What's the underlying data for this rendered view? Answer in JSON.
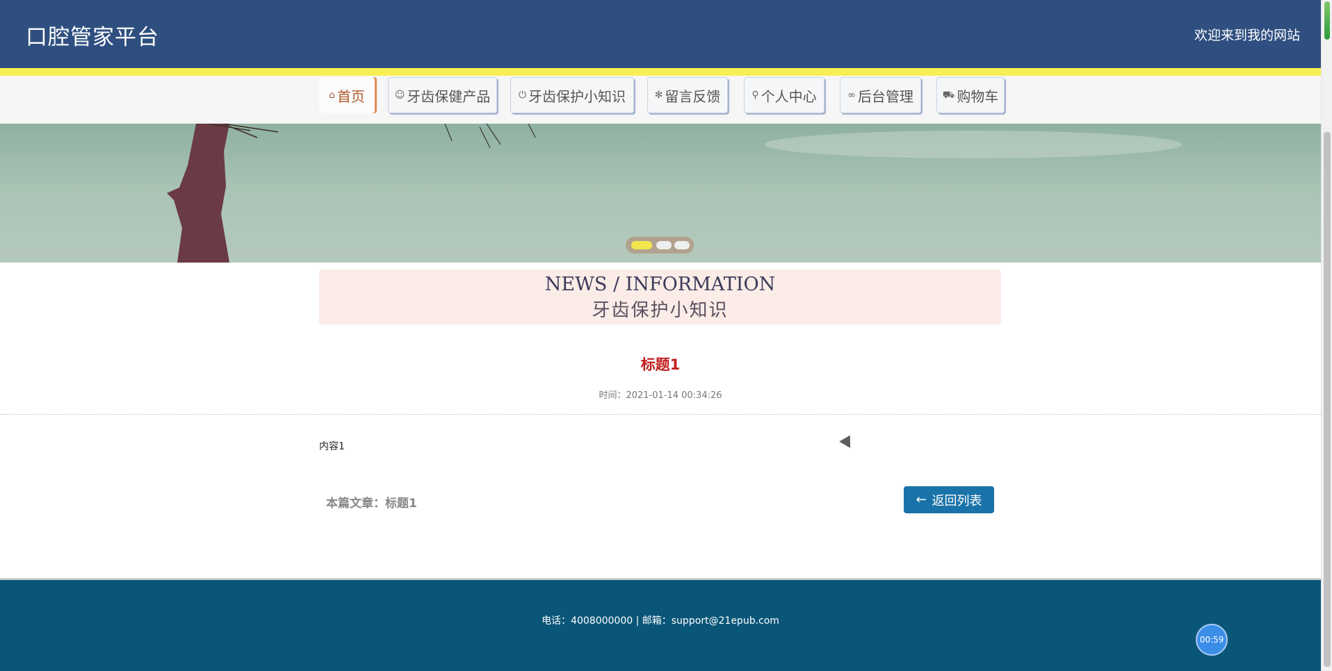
{
  "header": {
    "site_title": "口腔管家平台",
    "welcome_text": "欢迎来到我的网站"
  },
  "nav": {
    "items": [
      {
        "label": "首页",
        "icon": "⌂",
        "icon_name": "home-icon",
        "active": true
      },
      {
        "label": "牙齿保健产品",
        "icon": "☺",
        "icon_name": "smile-icon"
      },
      {
        "label": "牙齿保护小知识",
        "icon": "⏻",
        "icon_name": "power-icon"
      },
      {
        "label": "留言反馈",
        "icon": "✻",
        "icon_name": "snowflake-icon"
      },
      {
        "label": "个人中心",
        "icon": "⚲",
        "icon_name": "user-icon"
      },
      {
        "label": "后台管理",
        "icon": "∞",
        "icon_name": "link-icon"
      },
      {
        "label": "购物车",
        "icon": "⛟",
        "icon_name": "cart-icon"
      }
    ]
  },
  "carousel": {
    "slides": 3,
    "active_index": 0
  },
  "section": {
    "title_en": "NEWS / INFORMATION",
    "title_cn": "牙齿保护小知识"
  },
  "article": {
    "title": "标题1",
    "time": "时间：2021-01-14 00:34:26",
    "content": "内容1",
    "current_label": "本篇文章：标题1",
    "back_button": "返回列表"
  },
  "footer": {
    "contact": "电话：4008000000 | 邮箱：support@21epub.com"
  },
  "timer": {
    "value": "00:59"
  },
  "colors": {
    "header_bg": "#2f4f80",
    "accent_yellow": "#f8ef53",
    "title_red": "#c01e1e",
    "button_blue": "#1a73a8",
    "footer_bg": "#0a5678"
  }
}
